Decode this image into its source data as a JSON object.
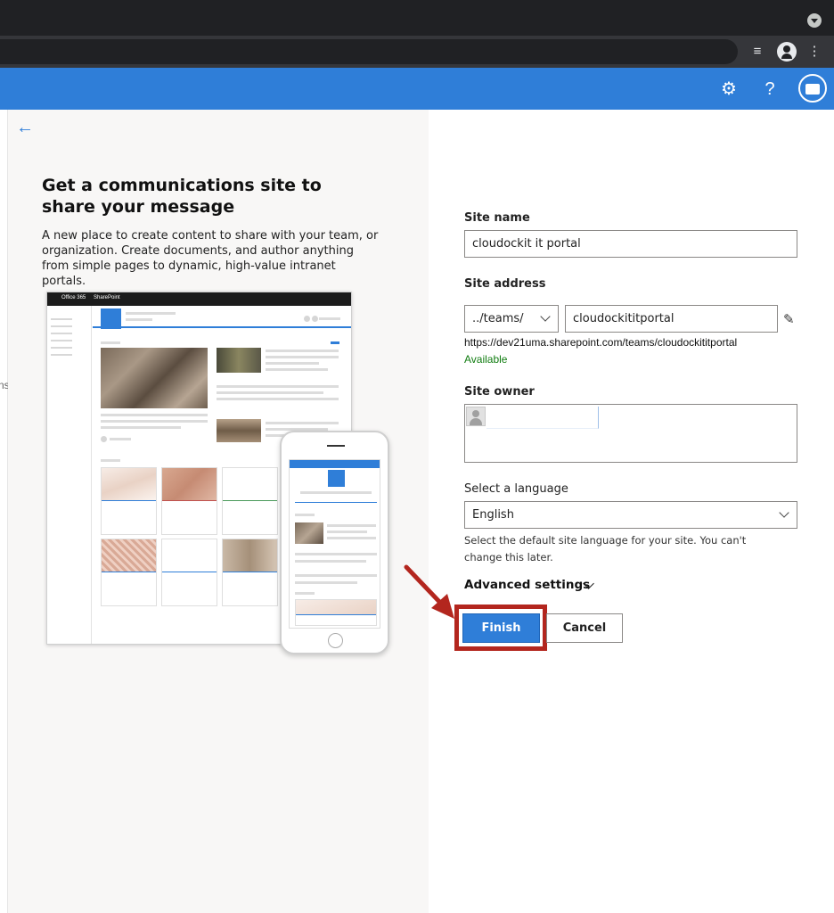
{
  "browser": {
    "icons": [
      "tab-search-icon",
      "media-control-icon",
      "profile-icon",
      "menu-icon"
    ]
  },
  "suite": {
    "icons": [
      "settings-icon",
      "help-icon",
      "account-avatar"
    ],
    "help_glyph": "?"
  },
  "left_sliver": {
    "text": "ns"
  },
  "info": {
    "headline": "Get a communications site to share your message",
    "description": "A new place to create content to share with your team, or organization. Create documents, and author anything from simple pages to dynamic, high-value intranet portals.",
    "illustration": {
      "suite_label": "Office 365",
      "app_label": "SharePoint"
    }
  },
  "form": {
    "site_name_label": "Site name",
    "site_name_value": "cloudockit it portal",
    "site_address_label": "Site address",
    "site_address_prefix": "../teams/",
    "site_address_value": "cloudockititportal",
    "site_url": "https://dev21uma.sharepoint.com/teams/cloudockititportal",
    "availability": "Available",
    "site_owner_label": "Site owner",
    "language_label": "Select a language",
    "language_value": "English",
    "language_help": "Select the default site language for your site. You can't change this later.",
    "advanced_label": "Advanced settings",
    "finish_label": "Finish",
    "cancel_label": "Cancel"
  },
  "colors": {
    "suite_blue": "#2f7ed8",
    "available_green": "#107c10",
    "highlight_red": "#b3261e"
  }
}
